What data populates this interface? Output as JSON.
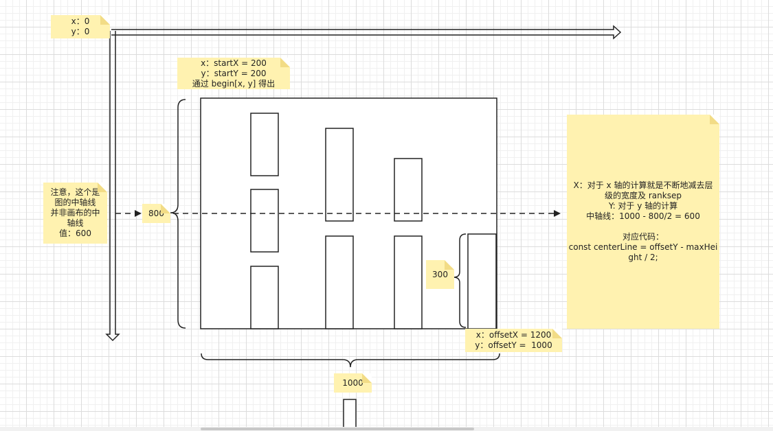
{
  "notes": {
    "origin": {
      "line1": "x：0",
      "line2": "y：0"
    },
    "start": {
      "line1": "x：startX = 200",
      "line2": "y：startY = 200",
      "line3": "通过 begin[x, y] 得出"
    },
    "center": {
      "line1": "注意，这个是",
      "line2": "图的中轴线",
      "line3": "并非画布的中",
      "line4": "轴线",
      "line5": "值：600"
    },
    "height_label": "800",
    "node_height_label": "300",
    "offset": {
      "line1": "x：offsetX = 1200",
      "line2": "y：offsetY =  1000"
    },
    "width_label": "1000",
    "explain": {
      "line1": "X：对于 x 轴的计算就是不断地减去层",
      "line2": "级的宽度及 ranksep",
      "line3": "Y: 对于 y 轴的计算",
      "line4": "中轴线：1000 - 800/2 = 600",
      "line5": "",
      "line6": "对应代码：",
      "line7": "const centerLine = offsetY - maxHei",
      "line8": "ght / 2;"
    }
  },
  "colors": {
    "note_bg": "#fff2b0",
    "stroke": "#222222",
    "grid": "#dcdcdc"
  }
}
